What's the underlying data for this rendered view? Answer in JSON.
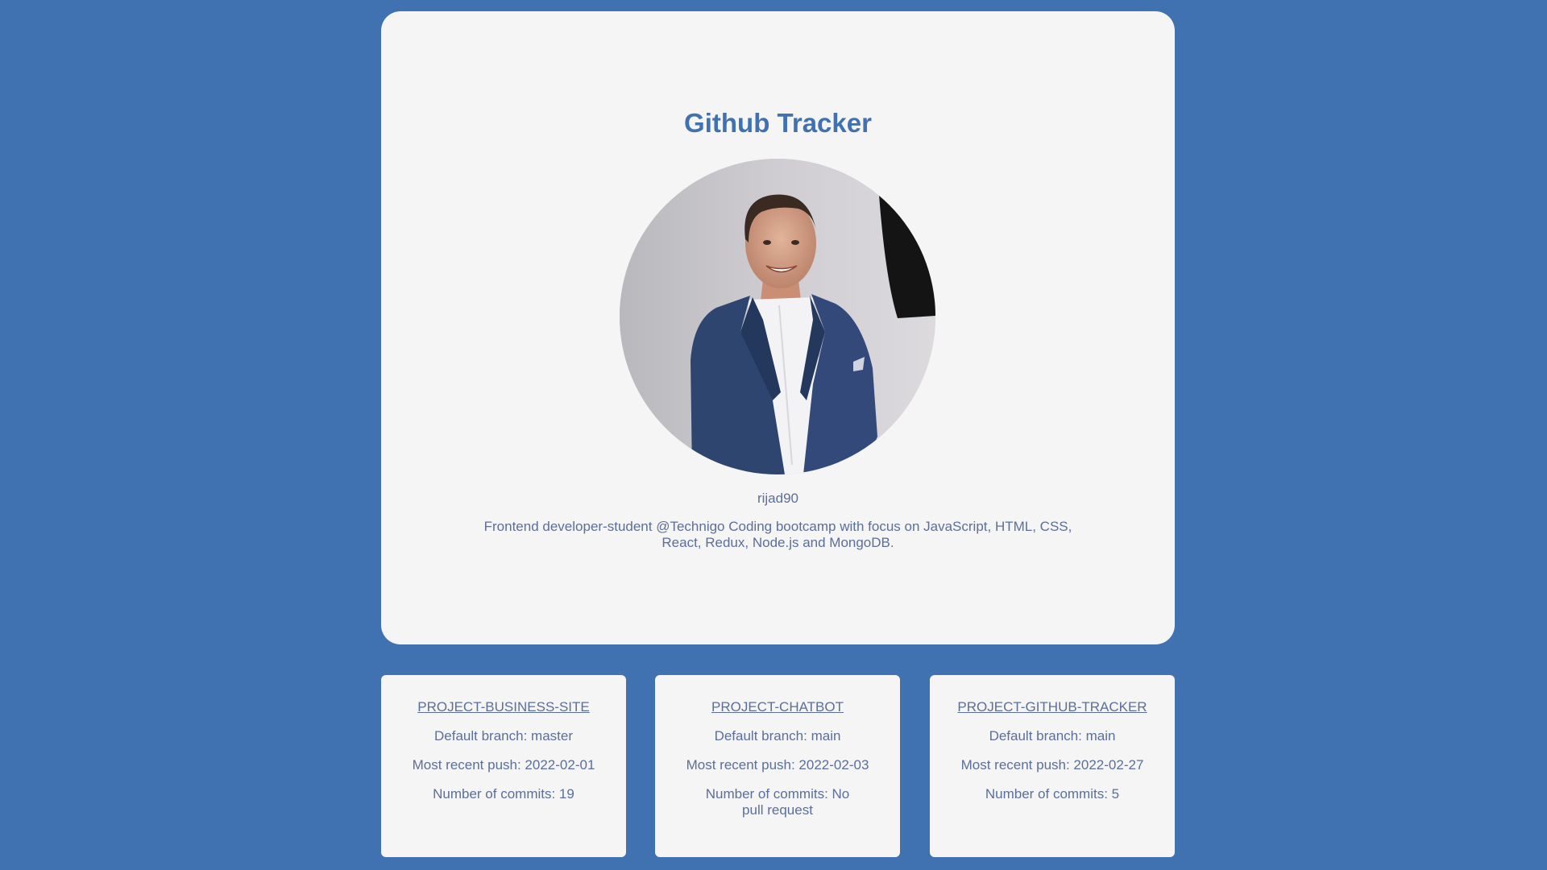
{
  "header": {
    "title": "Github Tracker"
  },
  "profile": {
    "username": "rijad90",
    "bio": "Frontend developer-student @Technigo Coding bootcamp with focus on JavaScript, HTML, CSS, React, Redux, Node.js and MongoDB.",
    "avatar_icon": "profile-photo"
  },
  "repos": [
    {
      "name": "PROJECT-BUSINESS-SITE",
      "branch": "Default branch: master",
      "push": "Most recent push: 2022-02-01",
      "commits": "Number of commits: 19"
    },
    {
      "name": "PROJECT-CHATBOT",
      "branch": "Default branch: main",
      "push": "Most recent push: 2022-02-03",
      "commits": "Number of commits: No pull request"
    },
    {
      "name": "PROJECT-GITHUB-TRACKER",
      "branch": "Default branch: main",
      "push": "Most recent push: 2022-02-27",
      "commits": "Number of commits: 5"
    }
  ],
  "colors": {
    "background": "#4072b1",
    "card": "#f5f5f5",
    "title": "#4072b1",
    "text": "#5b6f9a"
  }
}
